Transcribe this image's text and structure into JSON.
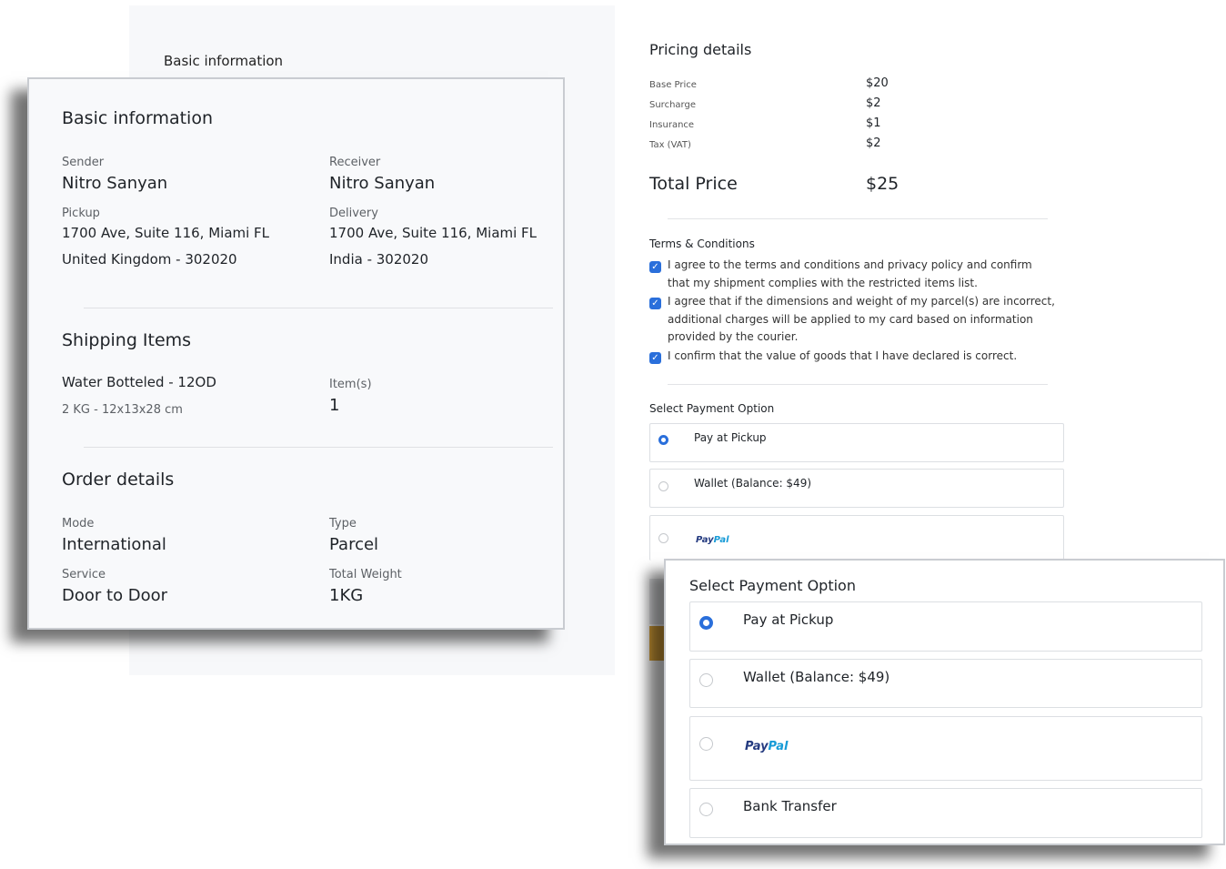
{
  "background": {
    "title": "Basic information"
  },
  "basic_info": {
    "title": "Basic information",
    "sender_label": "Sender",
    "sender_name": "Nitro Sanyan",
    "receiver_label": "Receiver",
    "receiver_name": "Nitro Sanyan",
    "pickup_label": "Pickup",
    "pickup_address": "1700 Ave, Suite 116, Miami FL",
    "pickup_country": "United Kingdom - 302020",
    "delivery_label": "Delivery",
    "delivery_address": "1700 Ave, Suite 116, Miami FL",
    "delivery_country": "India - 302020"
  },
  "shipping_items": {
    "title": "Shipping Items",
    "item_name": "Water Botteled - 12OD",
    "item_spec": "2 KG - 12x13x28 cm",
    "items_label": "Item(s)",
    "items_count": "1"
  },
  "order_details": {
    "title": "Order details",
    "mode_label": "Mode",
    "mode_value": "International",
    "type_label": "Type",
    "type_value": "Parcel",
    "service_label": "Service",
    "service_value": "Door to Door",
    "weight_label": "Total Weight",
    "weight_value": "1KG"
  },
  "pricing": {
    "title": "Pricing details",
    "rows": [
      {
        "label": "Base Price",
        "value": "$20"
      },
      {
        "label": "Surcharge",
        "value": "$2"
      },
      {
        "label": "Insurance",
        "value": "$1"
      },
      {
        "label": "Tax (VAT)",
        "value": "$2"
      }
    ],
    "total_label": "Total Price",
    "total_value": "$25"
  },
  "terms": {
    "title": "Terms & Conditions",
    "items": [
      {
        "text": "I agree to the terms and conditions and privacy policy and confirm that my shipment complies with the restricted items list.",
        "checked": true
      },
      {
        "text": "I agree that if the dimensions and weight of my parcel(s) are incorrect, additional charges will be applied to my card based on information provided by the courier.",
        "checked": true
      },
      {
        "text": "I confirm that the value of goods that I have declared is correct.",
        "checked": true
      }
    ]
  },
  "payment": {
    "title": "Select Payment Option",
    "options": [
      {
        "label": "Pay at Pickup",
        "selected": true
      },
      {
        "label": "Wallet (Balance: $49)",
        "selected": false
      },
      {
        "label": "PayPal",
        "selected": false
      },
      {
        "label": "Bank Transfer",
        "selected": false
      }
    ]
  },
  "colors": {
    "accent": "#2a6fdb",
    "button": "#d9a23a"
  }
}
